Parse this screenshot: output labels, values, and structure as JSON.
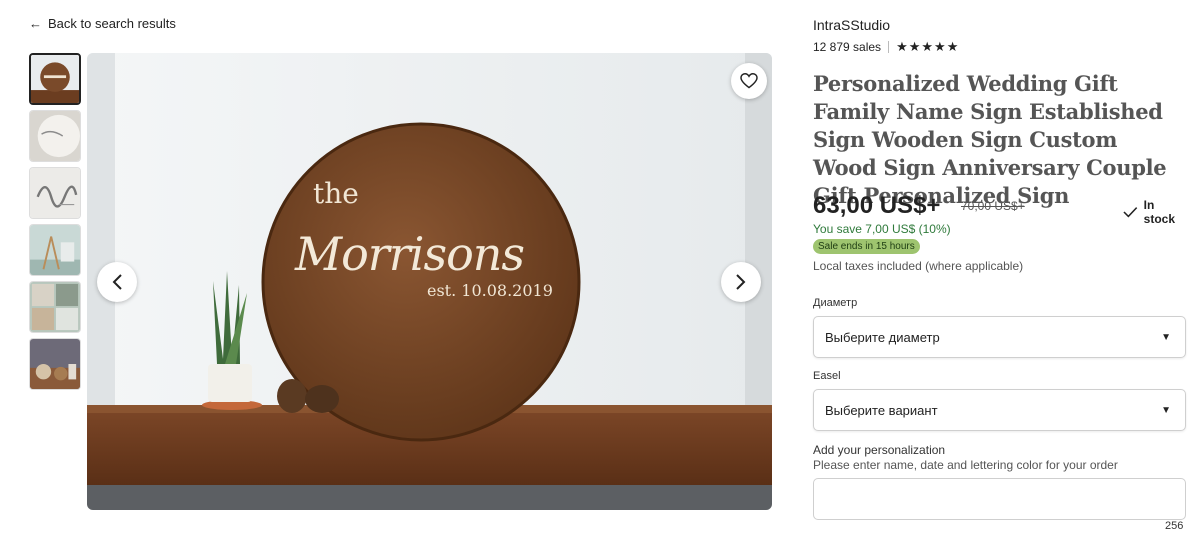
{
  "nav": {
    "back_label": "Back to search results"
  },
  "gallery": {
    "thumbnails": [
      "thumb-round-sign",
      "thumb-white-sign",
      "thumb-script-letters",
      "thumb-easel-display",
      "thumb-shop-collage",
      "thumb-shelf-signs"
    ],
    "hero_sign": {
      "line1": "the",
      "line2": "Morrisons",
      "line3": "est. 10.08.2019"
    }
  },
  "shop": {
    "name": "IntraSStudio",
    "sales": "12 879 sales",
    "rating_stars": 5
  },
  "product": {
    "title": "Personalized Wedding Gift Family Name Sign Established Sign Wooden Sign Custom Wood Sign Anniversary Couple Gift Personalized Sign",
    "price": "63,00 US$+",
    "old_price": "70,00 US$+",
    "stock": "In stock",
    "savings": "You save 7,00 US$ (10%)",
    "sale_badge": "Sale ends in 15 hours",
    "taxes": "Local taxes included (where applicable)"
  },
  "options": {
    "diameter_label": "Диаметр",
    "diameter_value": "Выберите диаметр",
    "easel_label": "Easel",
    "easel_value": "Выберите вариант"
  },
  "personalization": {
    "label": "Add your personalization",
    "hint": "Please enter name, date and lettering color for your order",
    "counter": "256"
  },
  "colors": {
    "wood": "#7a4a2a",
    "shelf": "#6b3d20",
    "wall": "#eef1f3",
    "badge": "#9ec46f",
    "save_text": "#2f7a3b"
  }
}
